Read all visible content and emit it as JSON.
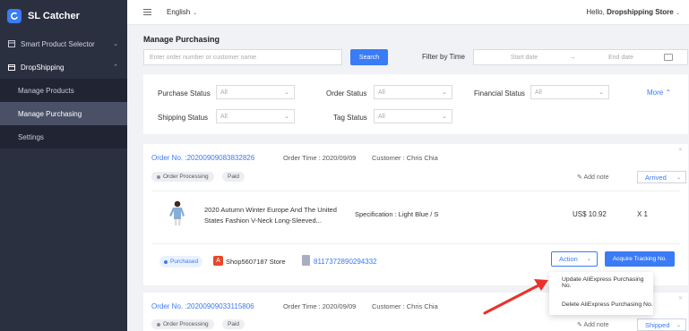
{
  "brand": {
    "name": "SL Catcher"
  },
  "sidebar": {
    "groups": [
      {
        "label": "Smart Product Selector"
      },
      {
        "label": "DropShipping"
      }
    ],
    "items": [
      {
        "label": "Manage Products"
      },
      {
        "label": "Manage Purchasing"
      },
      {
        "label": "Settings"
      }
    ]
  },
  "topbar": {
    "language": "English",
    "greeting_prefix": "Hello,",
    "store_name": "Dropshipping Store"
  },
  "page": {
    "title": "Manage Purchasing",
    "search_placeholder": "Enter order number or customer name",
    "search_button": "Search",
    "filter_by_time": "Filter by Time",
    "start_date_placeholder": "Start date",
    "date_separator": "→",
    "end_date_placeholder": "End date"
  },
  "filters": {
    "purchase_status": {
      "label": "Purchase Status",
      "value": "All"
    },
    "order_status": {
      "label": "Order Status",
      "value": "All"
    },
    "financial_status": {
      "label": "Financial Status",
      "value": "All"
    },
    "shipping_status": {
      "label": "Shipping Status",
      "value": "All"
    },
    "tag_status": {
      "label": "Tag Status",
      "value": "All"
    },
    "more": "More"
  },
  "orders": [
    {
      "order_no": "Order No. :20200909083832826",
      "order_time": "Order Time : 2020/09/09",
      "customer": "Customer : Chris Chia",
      "tags": [
        "Order Processing",
        "Paid"
      ],
      "add_note": "Add note",
      "status": "Arrived",
      "product_title": "2020 Autumn Winter Europe And The United States Fashion V-Neck Long-Sleeved...",
      "specification": "Specification : Light Blue / S",
      "price": "US$ 10.92",
      "quantity": "X 1",
      "purchase_tag": "Purchased",
      "store": "Shop5607187 Store",
      "tracking_number": "8117372890294332",
      "action_label": "Action",
      "acquire_label": "Acquire Tracking No."
    },
    {
      "order_no": "Order No. :20200909033115806",
      "order_time": "Order Time : 2020/09/09",
      "customer": "Customer : Chris Chia",
      "tags": [
        "Order Processing",
        "Paid"
      ],
      "add_note": "Add note",
      "status": "Shipped"
    }
  ],
  "action_menu": [
    {
      "label": "Update AliExpress Purchasing No."
    },
    {
      "label": "Delete AliExpress Purchasing No."
    }
  ],
  "colors": {
    "accent": "#3a7bf6",
    "sidebar_bg": "#2b3041",
    "annotation_arrow": "#e8322b"
  }
}
